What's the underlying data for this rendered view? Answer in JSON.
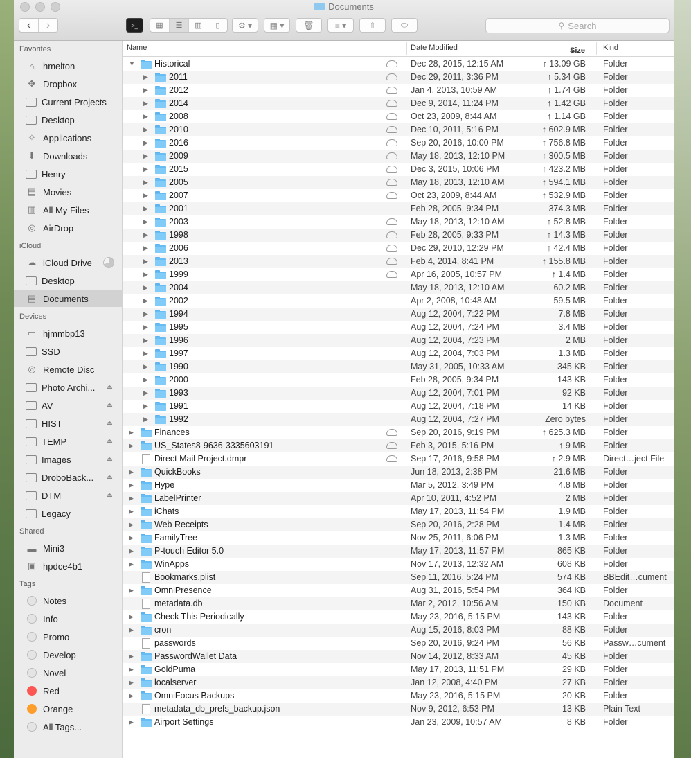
{
  "window": {
    "title": "Documents"
  },
  "toolbar": {
    "search_placeholder": "Search"
  },
  "columns": {
    "name": "Name",
    "date": "Date Modified",
    "size": "Size",
    "kind": "Kind"
  },
  "sidebar": {
    "favorites_label": "Favorites",
    "favorites": [
      {
        "label": "hmelton",
        "icon": "home-icon"
      },
      {
        "label": "Dropbox",
        "icon": "dropbox-icon"
      },
      {
        "label": "Current Projects",
        "icon": "folder-icon"
      },
      {
        "label": "Desktop",
        "icon": "desktop-icon"
      },
      {
        "label": "Applications",
        "icon": "applications-icon"
      },
      {
        "label": "Downloads",
        "icon": "downloads-icon"
      },
      {
        "label": "Henry",
        "icon": "folder-icon"
      },
      {
        "label": "Movies",
        "icon": "movies-icon"
      },
      {
        "label": "All My Files",
        "icon": "all-files-icon"
      },
      {
        "label": "AirDrop",
        "icon": "airdrop-icon"
      }
    ],
    "icloud_label": "iCloud",
    "icloud": [
      {
        "label": "iCloud Drive",
        "icon": "cloud-icon"
      },
      {
        "label": "Desktop",
        "icon": "desktop-icon"
      },
      {
        "label": "Documents",
        "icon": "documents-icon"
      }
    ],
    "devices_label": "Devices",
    "devices": [
      {
        "label": "hjmmbp13",
        "icon": "laptop-icon"
      },
      {
        "label": "SSD",
        "icon": "disk-icon"
      },
      {
        "label": "Remote Disc",
        "icon": "remote-disc-icon"
      },
      {
        "label": "Photo Archi...",
        "icon": "disk-icon"
      },
      {
        "label": "AV",
        "icon": "disk-icon"
      },
      {
        "label": "HIST",
        "icon": "disk-icon"
      },
      {
        "label": "TEMP",
        "icon": "disk-icon"
      },
      {
        "label": "Images",
        "icon": "disk-icon"
      },
      {
        "label": "DroboBack...",
        "icon": "disk-icon"
      },
      {
        "label": "DTM",
        "icon": "disk-icon"
      },
      {
        "label": "Legacy",
        "icon": "disk-icon"
      }
    ],
    "shared_label": "Shared",
    "shared": [
      {
        "label": "Mini3",
        "icon": "server-icon"
      },
      {
        "label": "hpdce4b1",
        "icon": "display-icon"
      }
    ],
    "tags_label": "Tags",
    "tags": [
      {
        "label": "Notes",
        "color": "#e4e4e4"
      },
      {
        "label": "Info",
        "color": "#e4e4e4"
      },
      {
        "label": "Promo",
        "color": "#e4e4e4"
      },
      {
        "label": "Develop",
        "color": "#e4e4e4"
      },
      {
        "label": "Novel",
        "color": "#e4e4e4"
      },
      {
        "label": "Red",
        "color": "#fc5753"
      },
      {
        "label": "Orange",
        "color": "#fd9d2b"
      },
      {
        "label": "All Tags...",
        "color": "#e4e4e4"
      }
    ]
  },
  "files": [
    {
      "name": "Historical",
      "date": "Dec 28, 2015, 12:15 AM",
      "size": "↑ 13.09 GB",
      "kind": "Folder",
      "level": 0,
      "disc": "open",
      "type": "folder",
      "cloud": true
    },
    {
      "name": "2011",
      "date": "Dec 29, 2011, 3:36 PM",
      "size": "↑ 5.34 GB",
      "kind": "Folder",
      "level": 1,
      "disc": "closed",
      "type": "folder",
      "cloud": true
    },
    {
      "name": "2012",
      "date": "Jan 4, 2013, 10:59 AM",
      "size": "↑ 1.74 GB",
      "kind": "Folder",
      "level": 1,
      "disc": "closed",
      "type": "folder",
      "cloud": true
    },
    {
      "name": "2014",
      "date": "Dec 9, 2014, 11:24 PM",
      "size": "↑ 1.42 GB",
      "kind": "Folder",
      "level": 1,
      "disc": "closed",
      "type": "folder",
      "cloud": true
    },
    {
      "name": "2008",
      "date": "Oct 23, 2009, 8:44 AM",
      "size": "↑ 1.14 GB",
      "kind": "Folder",
      "level": 1,
      "disc": "closed",
      "type": "folder",
      "cloud": true
    },
    {
      "name": "2010",
      "date": "Dec 10, 2011, 5:16 PM",
      "size": "↑ 602.9 MB",
      "kind": "Folder",
      "level": 1,
      "disc": "closed",
      "type": "folder",
      "cloud": true
    },
    {
      "name": "2016",
      "date": "Sep 20, 2016, 10:00 PM",
      "size": "↑ 756.8 MB",
      "kind": "Folder",
      "level": 1,
      "disc": "closed",
      "type": "folder",
      "cloud": true
    },
    {
      "name": "2009",
      "date": "May 18, 2013, 12:10 PM",
      "size": "↑ 300.5 MB",
      "kind": "Folder",
      "level": 1,
      "disc": "closed",
      "type": "folder",
      "cloud": true
    },
    {
      "name": "2015",
      "date": "Dec 3, 2015, 10:06 PM",
      "size": "↑ 423.2 MB",
      "kind": "Folder",
      "level": 1,
      "disc": "closed",
      "type": "folder",
      "cloud": true
    },
    {
      "name": "2005",
      "date": "May 18, 2013, 12:10 AM",
      "size": "↑ 594.1 MB",
      "kind": "Folder",
      "level": 1,
      "disc": "closed",
      "type": "folder",
      "cloud": true
    },
    {
      "name": "2007",
      "date": "Oct 23, 2009, 8:44 AM",
      "size": "↑ 532.9 MB",
      "kind": "Folder",
      "level": 1,
      "disc": "closed",
      "type": "folder",
      "cloud": true
    },
    {
      "name": "2001",
      "date": "Feb 28, 2005, 9:34 PM",
      "size": "374.3 MB",
      "kind": "Folder",
      "level": 1,
      "disc": "closed",
      "type": "folder",
      "cloud": false
    },
    {
      "name": "2003",
      "date": "May 18, 2013, 12:10 AM",
      "size": "↑ 52.8 MB",
      "kind": "Folder",
      "level": 1,
      "disc": "closed",
      "type": "folder",
      "cloud": true
    },
    {
      "name": "1998",
      "date": "Feb 28, 2005, 9:33 PM",
      "size": "↑ 14.3 MB",
      "kind": "Folder",
      "level": 1,
      "disc": "closed",
      "type": "folder",
      "cloud": true
    },
    {
      "name": "2006",
      "date": "Dec 29, 2010, 12:29 PM",
      "size": "↑ 42.4 MB",
      "kind": "Folder",
      "level": 1,
      "disc": "closed",
      "type": "folder",
      "cloud": true
    },
    {
      "name": "2013",
      "date": "Feb 4, 2014, 8:41 PM",
      "size": "↑ 155.8 MB",
      "kind": "Folder",
      "level": 1,
      "disc": "closed",
      "type": "folder",
      "cloud": true
    },
    {
      "name": "1999",
      "date": "Apr 16, 2005, 10:57 PM",
      "size": "↑ 1.4 MB",
      "kind": "Folder",
      "level": 1,
      "disc": "closed",
      "type": "folder",
      "cloud": true
    },
    {
      "name": "2004",
      "date": "May 18, 2013, 12:10 AM",
      "size": "60.2 MB",
      "kind": "Folder",
      "level": 1,
      "disc": "closed",
      "type": "folder",
      "cloud": false
    },
    {
      "name": "2002",
      "date": "Apr 2, 2008, 10:48 AM",
      "size": "59.5 MB",
      "kind": "Folder",
      "level": 1,
      "disc": "closed",
      "type": "folder",
      "cloud": false
    },
    {
      "name": "1994",
      "date": "Aug 12, 2004, 7:22 PM",
      "size": "7.8 MB",
      "kind": "Folder",
      "level": 1,
      "disc": "closed",
      "type": "folder",
      "cloud": false
    },
    {
      "name": "1995",
      "date": "Aug 12, 2004, 7:24 PM",
      "size": "3.4 MB",
      "kind": "Folder",
      "level": 1,
      "disc": "closed",
      "type": "folder",
      "cloud": false
    },
    {
      "name": "1996",
      "date": "Aug 12, 2004, 7:23 PM",
      "size": "2 MB",
      "kind": "Folder",
      "level": 1,
      "disc": "closed",
      "type": "folder",
      "cloud": false
    },
    {
      "name": "1997",
      "date": "Aug 12, 2004, 7:03 PM",
      "size": "1.3 MB",
      "kind": "Folder",
      "level": 1,
      "disc": "closed",
      "type": "folder",
      "cloud": false
    },
    {
      "name": "1990",
      "date": "May 31, 2005, 10:33 AM",
      "size": "345 KB",
      "kind": "Folder",
      "level": 1,
      "disc": "closed",
      "type": "folder",
      "cloud": false
    },
    {
      "name": "2000",
      "date": "Feb 28, 2005, 9:34 PM",
      "size": "143 KB",
      "kind": "Folder",
      "level": 1,
      "disc": "closed",
      "type": "folder",
      "cloud": false
    },
    {
      "name": "1993",
      "date": "Aug 12, 2004, 7:01 PM",
      "size": "92 KB",
      "kind": "Folder",
      "level": 1,
      "disc": "closed",
      "type": "folder",
      "cloud": false
    },
    {
      "name": "1991",
      "date": "Aug 12, 2004, 7:18 PM",
      "size": "14 KB",
      "kind": "Folder",
      "level": 1,
      "disc": "closed",
      "type": "folder",
      "cloud": false
    },
    {
      "name": "1992",
      "date": "Aug 12, 2004, 7:27 PM",
      "size": "Zero bytes",
      "kind": "Folder",
      "level": 1,
      "disc": "closed",
      "type": "folder",
      "cloud": false
    },
    {
      "name": "Finances",
      "date": "Sep 20, 2016, 9:19 PM",
      "size": "↑ 625.3 MB",
      "kind": "Folder",
      "level": 0,
      "disc": "closed",
      "type": "folder",
      "cloud": true
    },
    {
      "name": "US_States8-9636-3335603191",
      "date": "Feb 3, 2015, 5:16 PM",
      "size": "↑ 9 MB",
      "kind": "Folder",
      "level": 0,
      "disc": "closed",
      "type": "folder",
      "cloud": true
    },
    {
      "name": "Direct Mail Project.dmpr",
      "date": "Sep 17, 2016, 9:58 PM",
      "size": "↑ 2.9 MB",
      "kind": "Direct…ject File",
      "level": 0,
      "disc": "none",
      "type": "doc",
      "cloud": true
    },
    {
      "name": "QuickBooks",
      "date": "Jun 18, 2013, 2:38 PM",
      "size": "21.6 MB",
      "kind": "Folder",
      "level": 0,
      "disc": "closed",
      "type": "folder",
      "cloud": false
    },
    {
      "name": "Hype",
      "date": "Mar 5, 2012, 3:49 PM",
      "size": "4.8 MB",
      "kind": "Folder",
      "level": 0,
      "disc": "closed",
      "type": "folder",
      "cloud": false
    },
    {
      "name": "LabelPrinter",
      "date": "Apr 10, 2011, 4:52 PM",
      "size": "2 MB",
      "kind": "Folder",
      "level": 0,
      "disc": "closed",
      "type": "folder",
      "cloud": false
    },
    {
      "name": "iChats",
      "date": "May 17, 2013, 11:54 PM",
      "size": "1.9 MB",
      "kind": "Folder",
      "level": 0,
      "disc": "closed",
      "type": "folder",
      "cloud": false
    },
    {
      "name": "Web Receipts",
      "date": "Sep 20, 2016, 2:28 PM",
      "size": "1.4 MB",
      "kind": "Folder",
      "level": 0,
      "disc": "closed",
      "type": "folder",
      "cloud": false
    },
    {
      "name": "FamilyTree",
      "date": "Nov 25, 2011, 6:06 PM",
      "size": "1.3 MB",
      "kind": "Folder",
      "level": 0,
      "disc": "closed",
      "type": "folder",
      "cloud": false
    },
    {
      "name": "P-touch Editor 5.0",
      "date": "May 17, 2013, 11:57 PM",
      "size": "865 KB",
      "kind": "Folder",
      "level": 0,
      "disc": "closed",
      "type": "folder",
      "cloud": false
    },
    {
      "name": "WinApps",
      "date": "Nov 17, 2013, 12:32 AM",
      "size": "608 KB",
      "kind": "Folder",
      "level": 0,
      "disc": "closed",
      "type": "folder",
      "cloud": false
    },
    {
      "name": "Bookmarks.plist",
      "date": "Sep 11, 2016, 5:24 PM",
      "size": "574 KB",
      "kind": "BBEdit…cument",
      "level": 0,
      "disc": "none",
      "type": "doc",
      "cloud": false
    },
    {
      "name": "OmniPresence",
      "date": "Aug 31, 2016, 5:54 PM",
      "size": "364 KB",
      "kind": "Folder",
      "level": 0,
      "disc": "closed",
      "type": "folder",
      "cloud": false
    },
    {
      "name": "metadata.db",
      "date": "Mar 2, 2012, 10:56 AM",
      "size": "150 KB",
      "kind": "Document",
      "level": 0,
      "disc": "none",
      "type": "doc",
      "cloud": false
    },
    {
      "name": "Check This Periodically",
      "date": "May 23, 2016, 5:15 PM",
      "size": "143 KB",
      "kind": "Folder",
      "level": 0,
      "disc": "closed",
      "type": "folder",
      "cloud": false
    },
    {
      "name": "cron",
      "date": "Aug 15, 2016, 8:03 PM",
      "size": "88 KB",
      "kind": "Folder",
      "level": 0,
      "disc": "closed",
      "type": "folder",
      "cloud": false
    },
    {
      "name": "passwords",
      "date": "Sep 20, 2016, 9:24 PM",
      "size": "56 KB",
      "kind": "Passw…cument",
      "level": 0,
      "disc": "none",
      "type": "doc",
      "cloud": false
    },
    {
      "name": "PasswordWallet Data",
      "date": "Nov 14, 2012, 8:33 AM",
      "size": "45 KB",
      "kind": "Folder",
      "level": 0,
      "disc": "closed",
      "type": "folder",
      "cloud": false
    },
    {
      "name": "GoldPuma",
      "date": "May 17, 2013, 11:51 PM",
      "size": "29 KB",
      "kind": "Folder",
      "level": 0,
      "disc": "closed",
      "type": "folder",
      "cloud": false
    },
    {
      "name": "localserver",
      "date": "Jan 12, 2008, 4:40 PM",
      "size": "27 KB",
      "kind": "Folder",
      "level": 0,
      "disc": "closed",
      "type": "folder",
      "cloud": false
    },
    {
      "name": "OmniFocus Backups",
      "date": "May 23, 2016, 5:15 PM",
      "size": "20 KB",
      "kind": "Folder",
      "level": 0,
      "disc": "closed",
      "type": "folder",
      "cloud": false
    },
    {
      "name": "metadata_db_prefs_backup.json",
      "date": "Nov 9, 2012, 6:53 PM",
      "size": "13 KB",
      "kind": "Plain Text",
      "level": 0,
      "disc": "none",
      "type": "doc",
      "cloud": false
    },
    {
      "name": "Airport Settings",
      "date": "Jan 23, 2009, 10:57 AM",
      "size": "8 KB",
      "kind": "Folder",
      "level": 0,
      "disc": "closed",
      "type": "folder",
      "cloud": false
    }
  ]
}
